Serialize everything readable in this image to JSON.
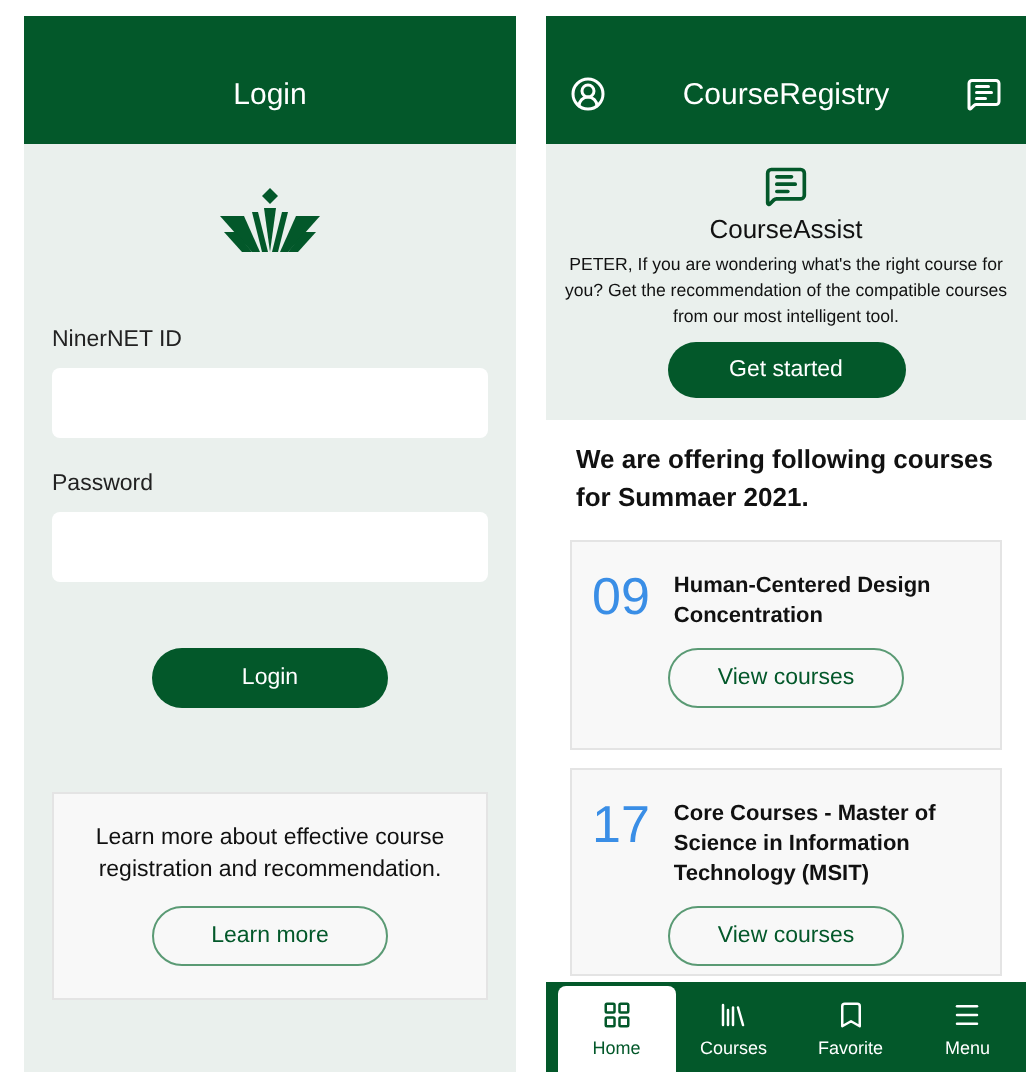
{
  "login_screen": {
    "header": {
      "title": "Login"
    },
    "fields": [
      {
        "label": "NinerNET ID"
      },
      {
        "label": "Password"
      }
    ],
    "login_button": "Login",
    "info_card": {
      "text": "Learn more about effective course registration and recommendation.",
      "button": "Learn more"
    }
  },
  "registry_screen": {
    "header": {
      "title": "CourseRegistry"
    },
    "assist": {
      "title": "CourseAssist",
      "text": "PETER, If you are wondering what's the right course for you? Get the recommendation of the compatible courses from our most intelligent tool.",
      "button": "Get started"
    },
    "heading": "We are offering following courses for Summaer 2021.",
    "courses": [
      {
        "count": "09",
        "title": "Human-Centered Design Concentration",
        "button": "View courses"
      },
      {
        "count": "17",
        "title": "Core Courses - Master of Science in Information Technology (MSIT)",
        "button": "View courses"
      }
    ],
    "nav": [
      {
        "label": "Home",
        "selected": true
      },
      {
        "label": "Courses",
        "selected": false
      },
      {
        "label": "Favorite",
        "selected": false
      },
      {
        "label": "Menu",
        "selected": false
      }
    ]
  }
}
